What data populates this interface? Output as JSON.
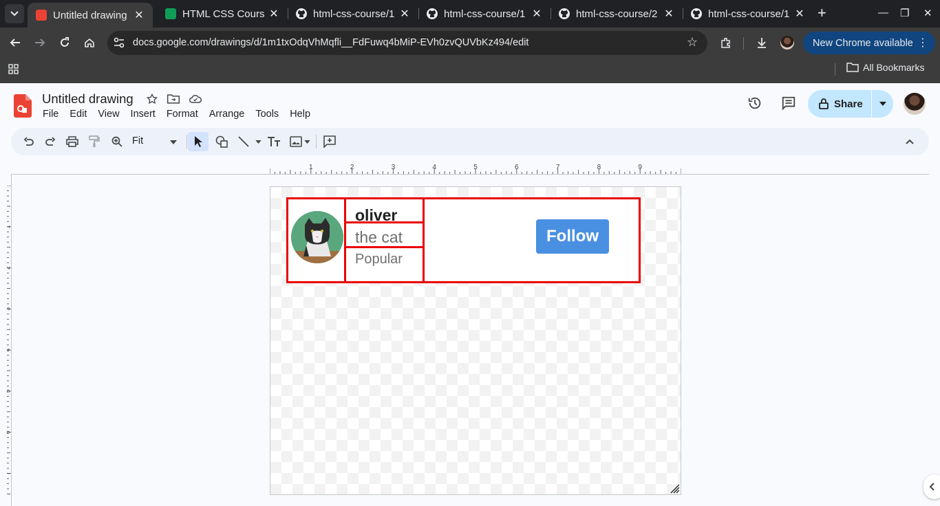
{
  "browser": {
    "tabs": [
      {
        "title": "Untitled drawing",
        "favicon": "google-drawings-icon",
        "active": true
      },
      {
        "title": "HTML CSS Course",
        "favicon": "google-sheets-icon",
        "active": false
      },
      {
        "title": "html-css-course/1",
        "favicon": "github-icon",
        "active": false
      },
      {
        "title": "html-css-course/1",
        "favicon": "github-icon",
        "active": false
      },
      {
        "title": "html-css-course/2",
        "favicon": "github-icon",
        "active": false
      },
      {
        "title": "html-css-course/1",
        "favicon": "github-icon",
        "active": false
      }
    ],
    "url": "docs.google.com/drawings/d/1m1txOdqVhMqfli__FdFuwq4bMiP-EVh0zvQUVbKz494/edit",
    "update_label": "New Chrome available",
    "all_bookmarks_label": "All Bookmarks"
  },
  "doc": {
    "title": "Untitled drawing",
    "menu": [
      "File",
      "Edit",
      "View",
      "Insert",
      "Format",
      "Arrange",
      "Tools",
      "Help"
    ],
    "share_label": "Share",
    "zoom": "Fit"
  },
  "ruler": {
    "horizontal_labels": [
      "1",
      "2",
      "3",
      "4",
      "5",
      "6",
      "7",
      "8",
      "9"
    ],
    "vertical_labels": [
      "1",
      "2",
      "3",
      "4",
      "5",
      "6",
      "7"
    ]
  },
  "drawing": {
    "name": "oliver",
    "subtitle": "the cat",
    "tag": "Popular",
    "button_label": "Follow",
    "border_color": "#ea0000",
    "button_color": "#4a90e2"
  }
}
